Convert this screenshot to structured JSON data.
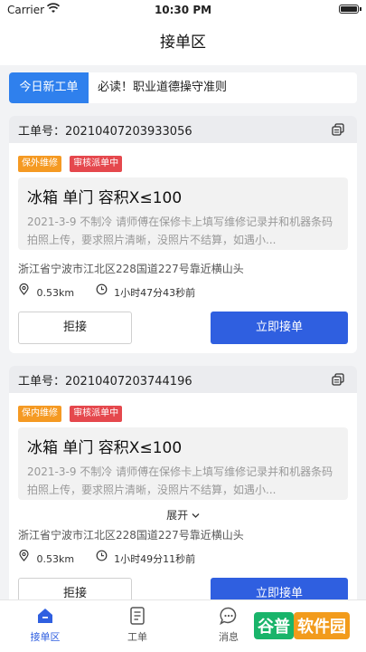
{
  "status_bar": {
    "carrier": "Carrier",
    "time": "10:30 PM"
  },
  "nav": {
    "title": "接单区"
  },
  "notice": {
    "tag": "今日新工单",
    "text": "必读！职业道德操守准则"
  },
  "orders": [
    {
      "order_no": "工单号：20210407203933056",
      "badges": [
        "保外维修",
        "审核派单中"
      ],
      "title": "冰箱  单门 容积X≤100",
      "desc": "2021-3-9 不制冷 请师傅在保修卡上填写维修记录并和机器条码拍照上传，要求照片清晰，没照片不结算，如遇小...",
      "address": "浙江省宁波市江北区228国道227号靠近横山头",
      "distance": "0.53km",
      "time_ago": "1小时47分43秒前",
      "reject_label": "拒接",
      "accept_label": "立即接单"
    },
    {
      "order_no": "工单号：20210407203744196",
      "badges": [
        "保内维修",
        "审核派单中"
      ],
      "title": "冰箱  单门 容积X≤100",
      "desc": "2021-3-9 不制冷 请师傅在保修卡上填写维修记录并和机器条码拍照上传，要求照片清晰，没照片不结算，如遇小...",
      "expand_label": "展开",
      "address": "浙江省宁波市江北区228国道227号靠近横山头",
      "distance": "0.53km",
      "time_ago": "1小时49分11秒前",
      "reject_label": "拒接",
      "accept_label": "立即接单"
    }
  ],
  "tabbar": {
    "tabs": [
      {
        "label": "接单区",
        "icon": "home-icon",
        "active": true
      },
      {
        "label": "工单",
        "icon": "document-icon",
        "active": false
      },
      {
        "label": "消息",
        "icon": "chat-icon",
        "active": false
      }
    ]
  },
  "watermark": {
    "part1": "谷普",
    "part2": "软件园"
  },
  "colors": {
    "accent": "#2f5fe0",
    "notice_tag": "#2f80ed",
    "badge_orange": "#f59a23",
    "badge_red": "#e5484d"
  }
}
